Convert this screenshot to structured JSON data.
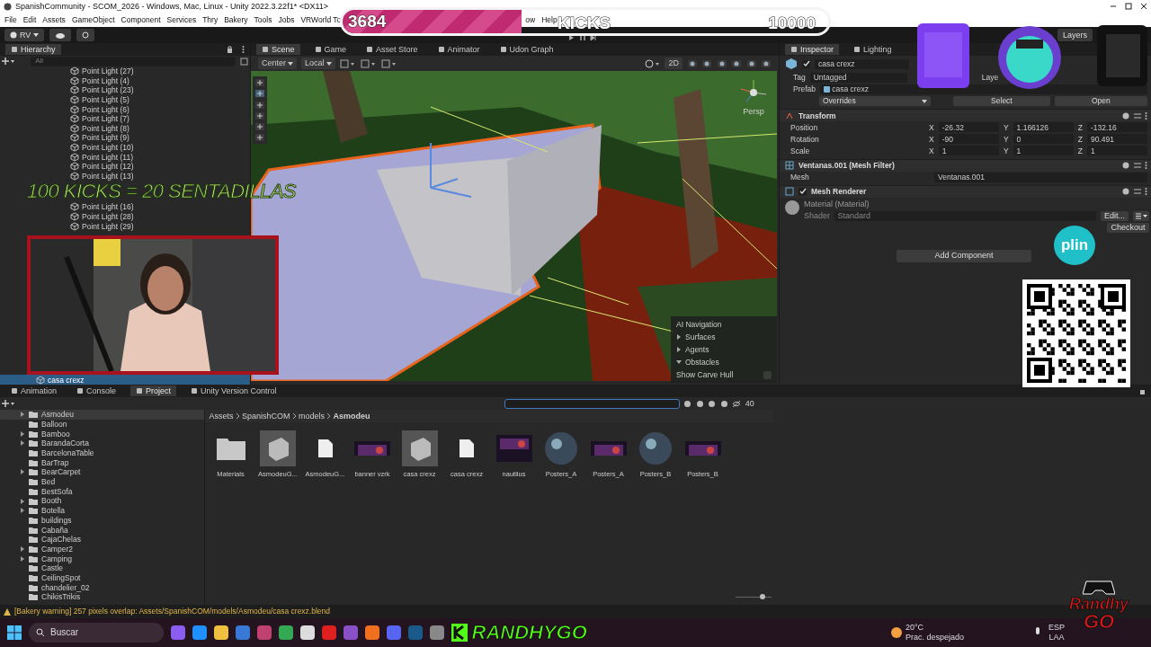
{
  "window": {
    "title": "SpanishCommunity - SCOM_2026 - Windows, Mac, Linux - Unity 2022.3.22f1* <DX11>"
  },
  "menu": [
    "File",
    "Edit",
    "Assets",
    "GameObject",
    "Component",
    "Services",
    "Thry",
    "Bakery",
    "Tools",
    "Jobs",
    "VRWorld To",
    "ow",
    "Help"
  ],
  "toolbar": {
    "account": "RV",
    "layers": "Layers"
  },
  "kicks_bar": {
    "count": "3684",
    "label": "KICKS",
    "goal": "10000",
    "level": 0.3684
  },
  "caption": "100 KICKS = 20 SENTADILLAS",
  "hierarchy": {
    "title": "Hierarchy",
    "placeholder": "All",
    "items": [
      {
        "label": "Point Light (27)",
        "selected": false
      },
      {
        "label": "Point Light (4)",
        "selected": false
      },
      {
        "label": "Point Light (23)",
        "selected": false
      },
      {
        "label": "Point Light (5)",
        "selected": false
      },
      {
        "label": "Point Light (6)",
        "selected": false
      },
      {
        "label": "Point Light (7)",
        "selected": false
      },
      {
        "label": "Point Light (8)",
        "selected": false
      },
      {
        "label": "Point Light (9)",
        "selected": false
      },
      {
        "label": "Point Light (10)",
        "selected": false
      },
      {
        "label": "Point Light (11)",
        "selected": false
      },
      {
        "label": "Point Light (12)",
        "selected": false
      },
      {
        "label": "Point Light (13)",
        "selected": false
      }
    ],
    "more_items": [
      {
        "label": "Point Light (16)",
        "selected": false
      },
      {
        "label": "Point Light (28)",
        "selected": false
      },
      {
        "label": "Point Light (29)",
        "selected": false
      }
    ],
    "bottom_item": {
      "label": "casa crexz",
      "selected": true
    }
  },
  "scene": {
    "tabs": [
      {
        "label": "Scene",
        "selected": true
      },
      {
        "label": "Game",
        "selected": false
      },
      {
        "label": "Asset Store",
        "selected": false
      },
      {
        "label": "Animator",
        "selected": false
      },
      {
        "label": "Udon Graph",
        "selected": false
      }
    ],
    "pivot": "Center",
    "space": "Local",
    "mode_2d": "2D",
    "projection": "Persp",
    "nav_overlay": {
      "title": "AI Navigation",
      "sections": [
        {
          "label": "Surfaces",
          "expanded": false
        },
        {
          "label": "Agents",
          "expanded": false
        },
        {
          "label": "Obstacles",
          "expanded": true
        }
      ],
      "option": {
        "label": "Show Carve Hull",
        "checked": false
      }
    }
  },
  "inspector": {
    "tabs": [
      {
        "label": "Inspector",
        "selected": true
      },
      {
        "label": "Lighting",
        "selected": false
      }
    ],
    "object_name": "casa crexz",
    "active": true,
    "tag_label": "Tag",
    "tag": "Untagged",
    "layer_label": "Laye",
    "prefab_label": "Prefab",
    "prefab": "casa crexz",
    "overrides": "Overrides",
    "select": "Select",
    "open": "Open",
    "transform": {
      "title": "Transform",
      "rows": [
        {
          "label": "Position",
          "values": [
            {
              "axis": "X",
              "value": "-26.32"
            },
            {
              "axis": "Y",
              "value": "1.166126"
            },
            {
              "axis": "Z",
              "value": "-132.16"
            }
          ]
        },
        {
          "label": "Rotation",
          "values": [
            {
              "axis": "X",
              "value": "-90"
            },
            {
              "axis": "Y",
              "value": "0"
            },
            {
              "axis": "Z",
              "value": "90.491"
            }
          ]
        },
        {
          "label": "Scale",
          "values": [
            {
              "axis": "X",
              "value": "1"
            },
            {
              "axis": "Y",
              "value": "1"
            },
            {
              "axis": "Z",
              "value": "1"
            }
          ]
        }
      ]
    },
    "mesh_filter": {
      "title": "Ventanas.001 (Mesh Filter)",
      "label": "Mesh",
      "value": "Ventanas.001"
    },
    "mesh_renderer": {
      "title": "Mesh Renderer",
      "enabled": true
    },
    "material": {
      "title": "Material (Material)",
      "shader_label": "Shader",
      "shader": "Standard",
      "edit": "Edit...",
      "checkout": "Checkout"
    },
    "add_component": "Add Component"
  },
  "plin": "plin",
  "project": {
    "tabs": [
      {
        "label": "Animation",
        "selected": false
      },
      {
        "label": "Console",
        "selected": false
      },
      {
        "label": "Project",
        "selected": true
      },
      {
        "label": "Unity Version Control",
        "selected": false
      }
    ],
    "count": "40",
    "folders": [
      {
        "label": "Asmodeu",
        "has_children": true,
        "selected": true
      },
      {
        "label": "Balloon",
        "has_children": false,
        "selected": false
      },
      {
        "label": "Bamboo",
        "has_children": true,
        "selected": false
      },
      {
        "label": "BarandaCorta",
        "has_children": true,
        "selected": false
      },
      {
        "label": "BarcelonaTable",
        "has_children": false,
        "selected": false
      },
      {
        "label": "BarTrap",
        "has_children": false,
        "selected": false
      },
      {
        "label": "BearCarpet",
        "has_children": true,
        "selected": false
      },
      {
        "label": "Bed",
        "has_children": false,
        "selected": false
      },
      {
        "label": "BestSofa",
        "has_children": false,
        "selected": false
      },
      {
        "label": "Booth",
        "has_children": true,
        "selected": false
      },
      {
        "label": "Botella",
        "has_children": true,
        "selected": false
      },
      {
        "label": "buildings",
        "has_children": false,
        "selected": false
      },
      {
        "label": "Cabaña",
        "has_children": false,
        "selected": false
      },
      {
        "label": "CajaChelas",
        "has_children": false,
        "selected": false
      },
      {
        "label": "Camper2",
        "has_children": true,
        "selected": false
      },
      {
        "label": "Camping",
        "has_children": true,
        "selected": false
      },
      {
        "label": "Castle",
        "has_children": false,
        "selected": false
      },
      {
        "label": "CeilingSpot",
        "has_children": false,
        "selected": false
      },
      {
        "label": "chandelier_02",
        "has_children": false,
        "selected": false
      },
      {
        "label": "ChikisTrikis",
        "has_children": false,
        "selected": false
      }
    ],
    "breadcrumb": [
      "Assets",
      "SpanishCOM",
      "models",
      "Asmodeu"
    ],
    "zoom_slider": {
      "level": 0.75
    },
    "assets": [
      {
        "label": "Materials",
        "kind": "folder"
      },
      {
        "label": "AsmodeuG...",
        "kind": "model"
      },
      {
        "label": "AsmodeuG...",
        "kind": "file"
      },
      {
        "label": "banner vzrk"
      },
      {
        "label": "casa crexz",
        "kind": "model"
      },
      {
        "label": "casa crexz",
        "kind": "file"
      },
      {
        "label": "nautilus"
      },
      {
        "label": "Posters_A",
        "kind": "material"
      },
      {
        "label": "Posters_A"
      },
      {
        "label": "Posters_B",
        "kind": "material"
      },
      {
        "label": "Posters_B"
      }
    ]
  },
  "status_bar": "[Bakery warning] 257 pixels overlap: Assets/SpanishCOM/models/Asmodeu/casa crexz.blend",
  "taskbar": {
    "search": "Buscar",
    "streamer": "RANDHYGO",
    "temperature": "20°C",
    "weather": "Prac. despejado",
    "lang": "ESP",
    "layout": "LAA"
  },
  "corner_logo": [
    "Randhy",
    "GO"
  ]
}
